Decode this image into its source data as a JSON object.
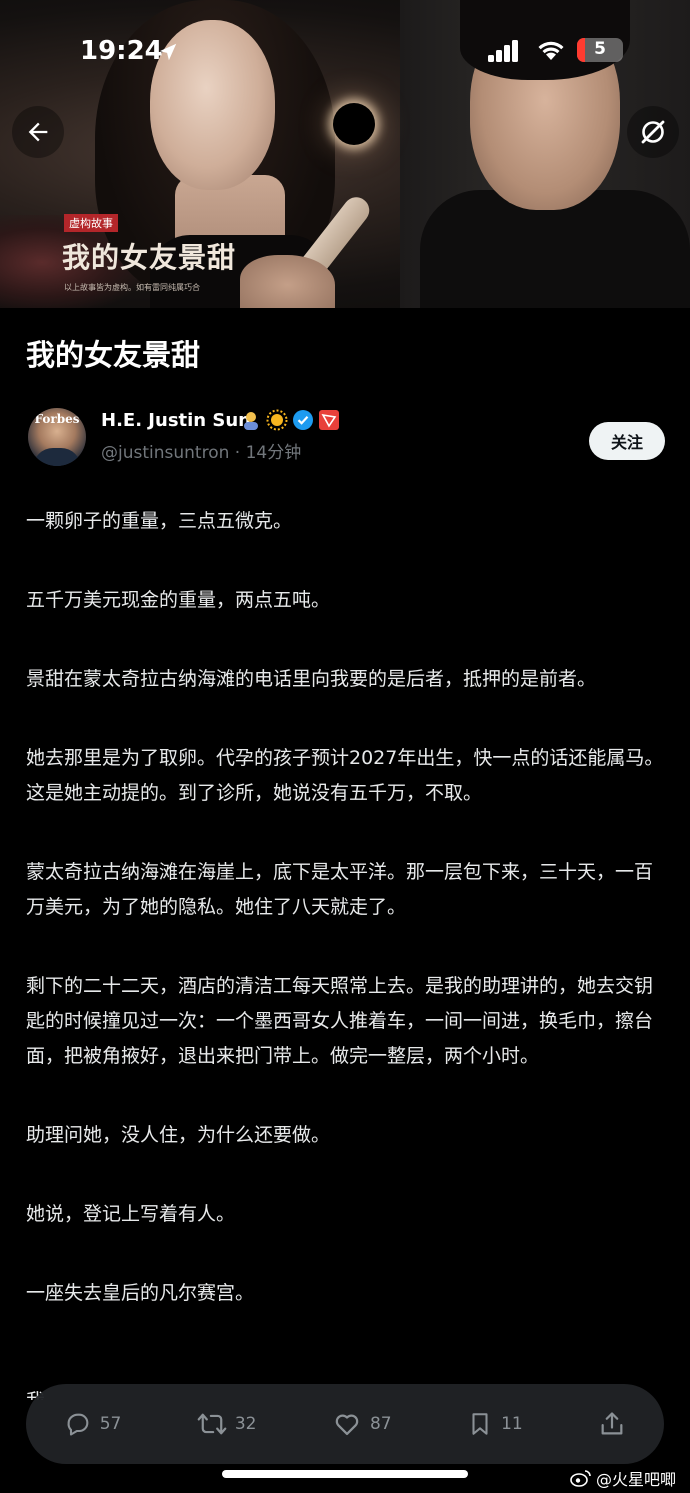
{
  "status_bar": {
    "time": "19:24",
    "battery": "5"
  },
  "hero": {
    "tag": "虚构故事",
    "poster_title": "我的女友景甜",
    "poster_subtitle": "以上故事皆为虚构。如有雷同纯属巧合"
  },
  "article": {
    "title": "我的女友景甜",
    "author": {
      "name": "H.E. Justin Sun",
      "handle": "@justinsuntron",
      "time": " · 14分钟"
    },
    "follow_label": "关注",
    "paragraphs": [
      "一颗卵子的重量，三点五微克。",
      "五千万美元现金的重量，两点五吨。",
      "景甜在蒙太奇拉古纳海滩的电话里向我要的是后者，抵押的是前者。",
      "她去那里是为了取卵。代孕的孩子预计2027年出生，快一点的话还能属马。这是她主动提的。到了诊所，她说没有五千万，不取。",
      "蒙太奇拉古纳海滩在海崖上，底下是太平洋。那一层包下来，三十天，一百万美元，为了她的隐私。她住了八天就走了。",
      "剩下的二十二天，酒店的清洁工每天照常上去。是我的助理讲的，她去交钥匙的时候撞见过一次：一个墨西哥女人推着车，一间一间进，换毛巾，擦台面，把被角掖好，退出来把门带上。做完一整层，两个小时。",
      "助理问她，没人住，为什么还要做。",
      "她说，登记上写着有人。",
      "一座失去皇后的凡尔赛宫。"
    ],
    "cut_line": "我"
  },
  "actions": {
    "reply": "57",
    "repost": "32",
    "like": "87",
    "bookmark": "11"
  },
  "watermark": "@火星吧唧"
}
